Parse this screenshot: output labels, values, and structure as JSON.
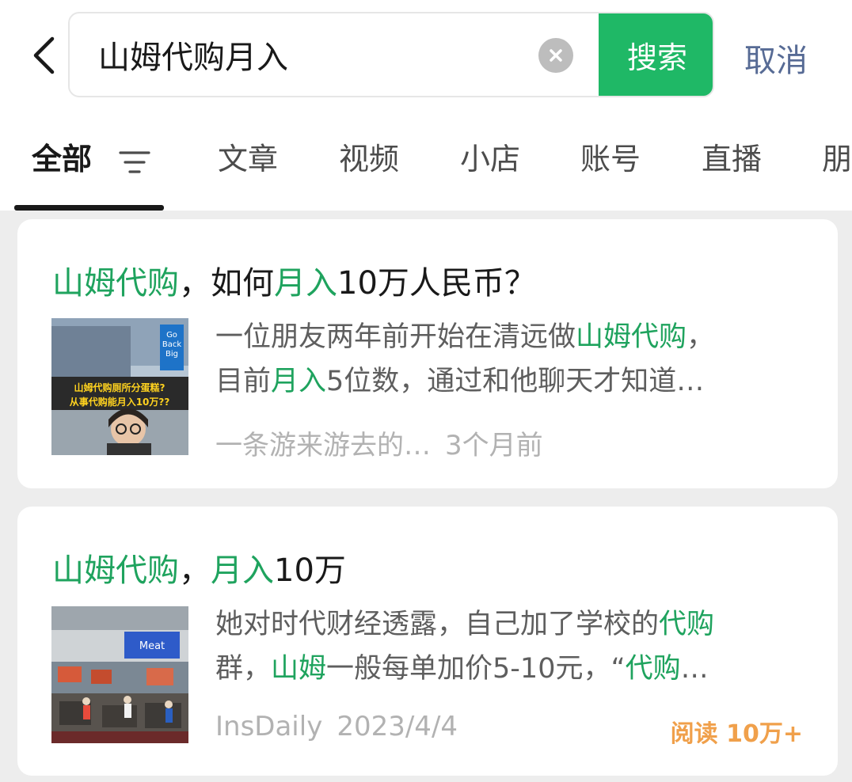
{
  "search": {
    "query": "山姆代购月入",
    "search_label": "搜索",
    "cancel_label": "取消"
  },
  "tabs": [
    {
      "label": "全部",
      "active": true
    },
    {
      "label": "文章"
    },
    {
      "label": "视频"
    },
    {
      "label": "小店"
    },
    {
      "label": "账号"
    },
    {
      "label": "直播"
    },
    {
      "label": "朋"
    }
  ],
  "results": [
    {
      "title_parts": [
        {
          "t": "山姆代购",
          "hl": true
        },
        {
          "t": "，如何"
        },
        {
          "t": "月入",
          "hl": true
        },
        {
          "t": "10万人民币？"
        }
      ],
      "thumb_text": [
        "Go",
        "Back",
        "Big",
        "山姆代购厕所分蛋糕?",
        "从事代购能月入10万??"
      ],
      "snippet_lines": [
        [
          {
            "t": "一位朋友两年前开始在清远做"
          },
          {
            "t": "山姆代购",
            "hl": true
          },
          {
            "t": "，"
          }
        ],
        [
          {
            "t": "目前"
          },
          {
            "t": "月入",
            "hl": true
          },
          {
            "t": "5位数，通过和他聊天才知道…"
          }
        ]
      ],
      "author": "一条游来游去的…",
      "time": "3个月前"
    },
    {
      "title_parts": [
        {
          "t": "山姆代购",
          "hl": true
        },
        {
          "t": "，"
        },
        {
          "t": "月入",
          "hl": true
        },
        {
          "t": "10万"
        }
      ],
      "thumb_text": [
        "Meat"
      ],
      "snippet_lines": [
        [
          {
            "t": "她对时代财经透露，自己加了学校的"
          },
          {
            "t": "代购",
            "hl": true
          }
        ],
        [
          {
            "t": "群，"
          },
          {
            "t": "山姆",
            "hl": true
          },
          {
            "t": "一般每单加价5-10元，“"
          },
          {
            "t": "代购",
            "hl": true
          },
          {
            "t": "…"
          }
        ]
      ],
      "author": "InsDaily",
      "time": "2023/4/4",
      "read_count": "阅读 10万+"
    }
  ],
  "colors": {
    "accent_green": "#1fb866",
    "highlight_green": "#1fa35e",
    "link_blue": "#576b95",
    "read_orange": "#f0a04b"
  }
}
